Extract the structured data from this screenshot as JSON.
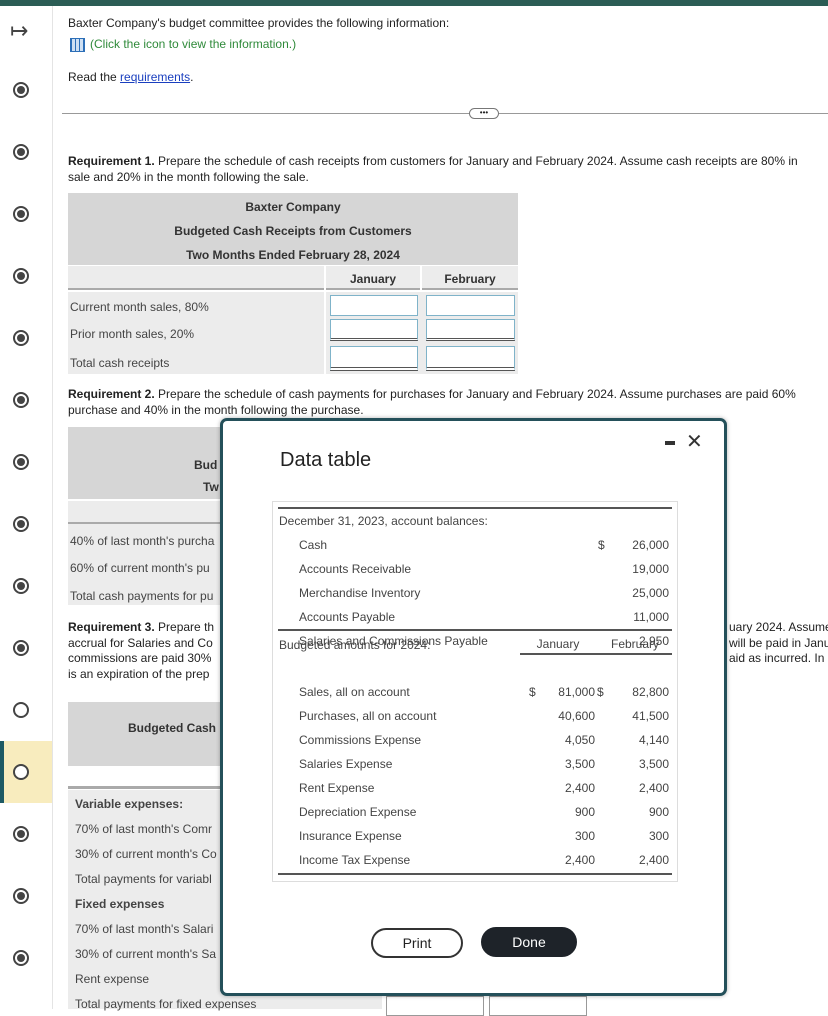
{
  "header": {
    "intro": "Baxter Company's budget committee provides the following information:",
    "info_link": "(Click the icon to view the information.)",
    "read_prefix": "Read the ",
    "requirements_link": "requirements",
    "read_suffix": ".",
    "icons": {
      "collapse": "arrow-right-bar-icon",
      "info": "table-grid-icon",
      "expander": "ellipsis-icon"
    }
  },
  "sidebar": {
    "items": [
      {
        "state": "answered"
      },
      {
        "state": "answered"
      },
      {
        "state": "answered"
      },
      {
        "state": "answered"
      },
      {
        "state": "answered"
      },
      {
        "state": "answered"
      },
      {
        "state": "answered"
      },
      {
        "state": "answered"
      },
      {
        "state": "answered"
      },
      {
        "state": "answered"
      },
      {
        "state": "unanswered"
      },
      {
        "state": "current"
      },
      {
        "state": "answered"
      },
      {
        "state": "answered"
      },
      {
        "state": "answered"
      }
    ]
  },
  "req1": {
    "label": "Requirement 1.",
    "text": " Prepare the schedule of cash receipts from customers for January and February 2024. Assume cash receipts are 80% in",
    "text2": "sale and 20% in the month following the sale.",
    "table": {
      "company": "Baxter Company",
      "title": "Budgeted Cash Receipts from Customers",
      "period": "Two Months Ended February 28, 2024",
      "columns": [
        "January",
        "February"
      ],
      "rows": [
        "Current month sales, 80%",
        "Prior month sales, 20%",
        "Total cash receipts"
      ]
    }
  },
  "req2": {
    "label": "Requirement 2.",
    "text": " Prepare the schedule of cash payments for purchases for January and February 2024. Assume purchases are paid 60%",
    "text2": "purchase and 40% in the month following the purchase.",
    "table": {
      "title_partial": "Bud",
      "period_partial": "Tw",
      "rows": [
        "40% of last month's purcha",
        "60% of current month's pu",
        "Total cash payments for pu"
      ]
    }
  },
  "req3": {
    "label": "Requirement 3.",
    "line1": " Prepare th",
    "line2": "accrual for Salaries and Co",
    "line3": "commissions are paid 30%",
    "line4": "is an expiration of the prep",
    "right1": "uary 2024. Assume",
    "right2": "will be paid in Janu",
    "right3": "aid as incurred. In",
    "table": {
      "title_partial": "Budgeted Cash",
      "rows": [
        "Variable expenses:",
        "70% of last month's Comr",
        "30% of current month's Co",
        "Total payments for variabl",
        "Fixed expenses",
        "70% of last month's Salari",
        "30% of current month's Sa",
        "Rent expense",
        "Total payments for fixed expenses"
      ]
    }
  },
  "modal": {
    "title": "Data table",
    "minimize_icon": "minimize-icon",
    "close_icon": "close-icon",
    "section1": "December 31, 2023, account balances:",
    "balances": [
      {
        "label": "Cash",
        "cur": "$",
        "value": "26,000"
      },
      {
        "label": "Accounts Receivable",
        "value": "19,000"
      },
      {
        "label": "Merchandise Inventory",
        "value": "25,000"
      },
      {
        "label": "Accounts Payable",
        "value": "11,000"
      },
      {
        "label": "Salaries and Commissions Payable",
        "value": "2,950"
      }
    ],
    "section2": "Budgeted amounts for 2024:",
    "columns": [
      "January",
      "February"
    ],
    "budget": [
      {
        "label": "Sales, all on account",
        "cur1": "$",
        "jan": "81,000",
        "cur2": "$",
        "feb": "82,800"
      },
      {
        "label": "Purchases, all on account",
        "jan": "40,600",
        "feb": "41,500"
      },
      {
        "label": "Commissions Expense",
        "jan": "4,050",
        "feb": "4,140"
      },
      {
        "label": "Salaries Expense",
        "jan": "3,500",
        "feb": "3,500"
      },
      {
        "label": "Rent Expense",
        "jan": "2,400",
        "feb": "2,400"
      },
      {
        "label": "Depreciation Expense",
        "jan": "900",
        "feb": "900"
      },
      {
        "label": "Insurance Expense",
        "jan": "300",
        "feb": "300"
      },
      {
        "label": "Income Tax Expense",
        "jan": "2,400",
        "feb": "2,400"
      }
    ],
    "print": "Print",
    "done": "Done"
  }
}
